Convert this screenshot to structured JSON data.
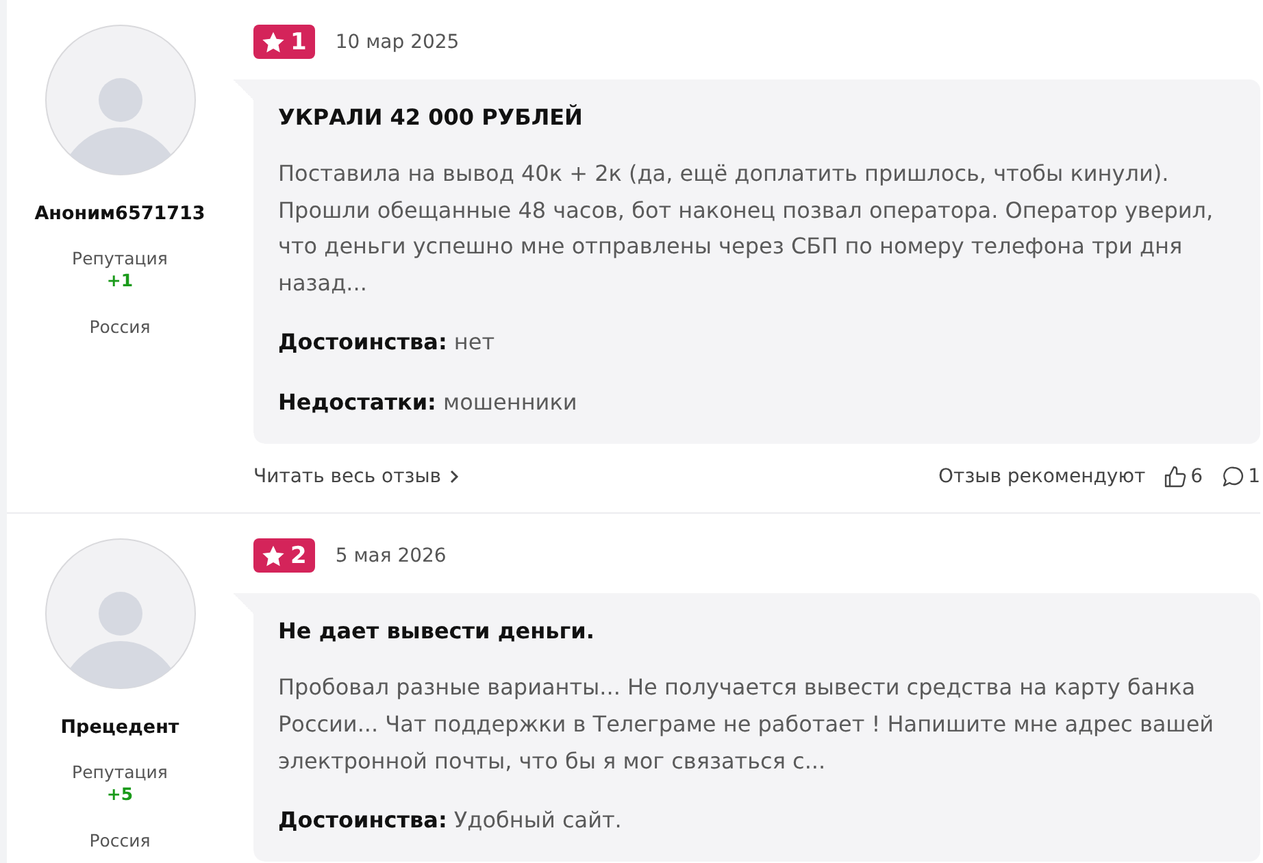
{
  "reviews": [
    {
      "author": {
        "name": "Аноним6571713",
        "reputation_label": "Репутация",
        "reputation": "+1",
        "location": "Россия"
      },
      "rating": "1",
      "date": "10 мар 2025",
      "title": "УКРАЛИ 42 000 РУБЛЕЙ",
      "body": "Поставила на вывод 40к + 2к (да, ещё доплатить пришлось, чтобы кинули).\nПрошли обещанные 48 часов, бот наконец позвал оператора. Оператор уверил, что деньги успешно мне отправлены через СБП по номеру телефона три дня назад...",
      "details": [
        "**Достоинства:** нет",
        "**Недостатки:** мошенники"
      ],
      "footer": {
        "read_more": "Читать весь отзыв",
        "recommend_label": "Отзыв рекомендуют",
        "likes": "6",
        "comments": "1"
      }
    },
    {
      "author": {
        "name": "Прецедент",
        "reputation_label": "Репутация",
        "reputation": "+5",
        "location": "Россия"
      },
      "rating": "2",
      "date": "5 мая 2026",
      "title": "Не дает вывести деньги.",
      "body": "Пробовал разные варианты... Не получается вывести средства на карту банка России... Чат поддержки в Телеграме не работает ! Напишите мне адрес вашей электронной почты, что бы я мог связаться с...",
      "details": [
        "**Достоинства:** Удобный сайт."
      ]
    }
  ]
}
